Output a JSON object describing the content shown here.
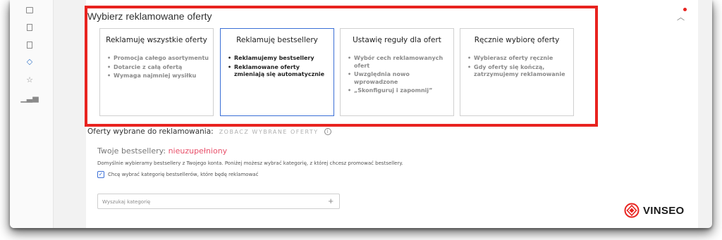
{
  "section": {
    "title": "Wybierz reklamowane oferty"
  },
  "cards": [
    {
      "title": "Reklamuję wszystkie oferty",
      "items": [
        "Promocja całego asortymentu",
        "Dotarcie z całą ofertą",
        "Wymaga najmniej wysiłku"
      ]
    },
    {
      "title": "Reklamuję bestsellery",
      "items": [
        "Reklamujemy bestsellery",
        "Reklamowane oferty zmieniają się automatycznie"
      ]
    },
    {
      "title": "Ustawię reguły dla ofert",
      "items": [
        "Wybór cech reklamowanych ofert",
        "Uwzględnia nowo wprowadzone",
        "„Skonfiguruj i zapomnij”"
      ]
    },
    {
      "title": "Ręcznie wybiorę oferty",
      "items": [
        "Wybierasz oferty ręcznie",
        "Gdy oferty się kończą, zatrzymujemy reklamowanie"
      ]
    }
  ],
  "selected_offers": {
    "label": "Oferty wybrane do reklamowania:",
    "link": "ZOBACZ WYBRANE OFERTY",
    "info_icon": "i"
  },
  "bestsellers": {
    "label": "Twoje bestsellery:",
    "status": "nieuzupełniony",
    "description": "Domyślnie wybieramy bestsellery z Twojego konta. Poniżej możesz wybrać kategorię, z której chcesz promować bestsellery.",
    "checkbox_label": "Chcę wybrać kategorię bestsellerów, które będę reklamować",
    "checkbox_checked": true
  },
  "search": {
    "placeholder": "Wyszukaj kategorię",
    "value": ""
  },
  "logo": {
    "text": "VINSEO"
  },
  "colors": {
    "highlight_red": "#e8231f",
    "selected_blue": "#3b6fd6",
    "status_pink": "#e8506a"
  }
}
